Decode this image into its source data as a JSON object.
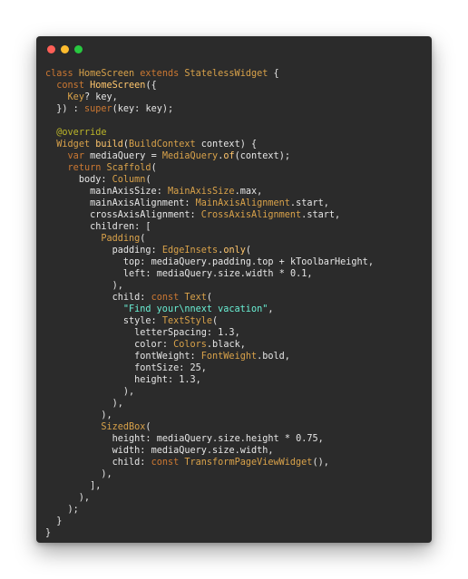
{
  "window": {
    "buttons": [
      {
        "name": "close",
        "color": "#ff5f57"
      },
      {
        "name": "minimize",
        "color": "#febc2e"
      },
      {
        "name": "maximize",
        "color": "#28c840"
      }
    ]
  },
  "code_lines": [
    [
      [
        "kw",
        "class "
      ],
      [
        "type",
        "HomeScreen "
      ],
      [
        "kw",
        "extends "
      ],
      [
        "type",
        "StatelessWidget "
      ],
      [
        "punc",
        "{"
      ]
    ],
    [
      [
        "punc",
        "  "
      ],
      [
        "kw",
        "const "
      ],
      [
        "fn",
        "HomeScreen"
      ],
      [
        "punc",
        "({"
      ]
    ],
    [
      [
        "punc",
        "    "
      ],
      [
        "type",
        "Key"
      ],
      [
        "punc",
        "? "
      ],
      [
        "id",
        "key"
      ],
      [
        "punc",
        ","
      ]
    ],
    [
      [
        "punc",
        "  }) : "
      ],
      [
        "kw",
        "super"
      ],
      [
        "punc",
        "("
      ],
      [
        "id",
        "key"
      ],
      [
        "punc",
        ": "
      ],
      [
        "id",
        "key"
      ],
      [
        "punc",
        ");"
      ]
    ],
    [
      [
        "punc",
        ""
      ]
    ],
    [
      [
        "punc",
        "  "
      ],
      [
        "ann",
        "@override"
      ]
    ],
    [
      [
        "punc",
        "  "
      ],
      [
        "type",
        "Widget "
      ],
      [
        "fn",
        "build"
      ],
      [
        "punc",
        "("
      ],
      [
        "type",
        "BuildContext "
      ],
      [
        "id",
        "context"
      ],
      [
        "punc",
        ") {"
      ]
    ],
    [
      [
        "punc",
        "    "
      ],
      [
        "kw",
        "var "
      ],
      [
        "id",
        "mediaQuery "
      ],
      [
        "punc",
        "= "
      ],
      [
        "type",
        "MediaQuery"
      ],
      [
        "punc",
        "."
      ],
      [
        "fn",
        "of"
      ],
      [
        "punc",
        "("
      ],
      [
        "id",
        "context"
      ],
      [
        "punc",
        ");"
      ]
    ],
    [
      [
        "punc",
        "    "
      ],
      [
        "kw",
        "return "
      ],
      [
        "type",
        "Scaffold"
      ],
      [
        "punc",
        "("
      ]
    ],
    [
      [
        "punc",
        "      "
      ],
      [
        "prop",
        "body"
      ],
      [
        "punc",
        ": "
      ],
      [
        "type",
        "Column"
      ],
      [
        "punc",
        "("
      ]
    ],
    [
      [
        "punc",
        "        "
      ],
      [
        "prop",
        "mainAxisSize"
      ],
      [
        "punc",
        ": "
      ],
      [
        "type",
        "MainAxisSize"
      ],
      [
        "punc",
        "."
      ],
      [
        "prop",
        "max"
      ],
      [
        "punc",
        ","
      ]
    ],
    [
      [
        "punc",
        "        "
      ],
      [
        "prop",
        "mainAxisAlignment"
      ],
      [
        "punc",
        ": "
      ],
      [
        "type",
        "MainAxisAlignment"
      ],
      [
        "punc",
        "."
      ],
      [
        "prop",
        "start"
      ],
      [
        "punc",
        ","
      ]
    ],
    [
      [
        "punc",
        "        "
      ],
      [
        "prop",
        "crossAxisAlignment"
      ],
      [
        "punc",
        ": "
      ],
      [
        "type",
        "CrossAxisAlignment"
      ],
      [
        "punc",
        "."
      ],
      [
        "prop",
        "start"
      ],
      [
        "punc",
        ","
      ]
    ],
    [
      [
        "punc",
        "        "
      ],
      [
        "prop",
        "children"
      ],
      [
        "punc",
        ": ["
      ]
    ],
    [
      [
        "punc",
        "          "
      ],
      [
        "type",
        "Padding"
      ],
      [
        "punc",
        "("
      ]
    ],
    [
      [
        "punc",
        "            "
      ],
      [
        "prop",
        "padding"
      ],
      [
        "punc",
        ": "
      ],
      [
        "type",
        "EdgeInsets"
      ],
      [
        "punc",
        "."
      ],
      [
        "fn",
        "only"
      ],
      [
        "punc",
        "("
      ]
    ],
    [
      [
        "punc",
        "              "
      ],
      [
        "prop",
        "top"
      ],
      [
        "punc",
        ": "
      ],
      [
        "id",
        "mediaQuery"
      ],
      [
        "punc",
        "."
      ],
      [
        "prop",
        "padding"
      ],
      [
        "punc",
        "."
      ],
      [
        "prop",
        "top "
      ],
      [
        "punc",
        "+ "
      ],
      [
        "id",
        "kToolbarHeight"
      ],
      [
        "punc",
        ","
      ]
    ],
    [
      [
        "punc",
        "              "
      ],
      [
        "prop",
        "left"
      ],
      [
        "punc",
        ": "
      ],
      [
        "id",
        "mediaQuery"
      ],
      [
        "punc",
        "."
      ],
      [
        "prop",
        "size"
      ],
      [
        "punc",
        "."
      ],
      [
        "prop",
        "width "
      ],
      [
        "punc",
        "* "
      ],
      [
        "num",
        "0.1"
      ],
      [
        "punc",
        ","
      ]
    ],
    [
      [
        "punc",
        "            ),"
      ]
    ],
    [
      [
        "punc",
        "            "
      ],
      [
        "prop",
        "child"
      ],
      [
        "punc",
        ": "
      ],
      [
        "kw",
        "const "
      ],
      [
        "type",
        "Text"
      ],
      [
        "punc",
        "("
      ]
    ],
    [
      [
        "punc",
        "              "
      ],
      [
        "str",
        "\"Find your\\nnext vacation\""
      ],
      [
        "punc",
        ","
      ]
    ],
    [
      [
        "punc",
        "              "
      ],
      [
        "prop",
        "style"
      ],
      [
        "punc",
        ": "
      ],
      [
        "type",
        "TextStyle"
      ],
      [
        "punc",
        "("
      ]
    ],
    [
      [
        "punc",
        "                "
      ],
      [
        "prop",
        "letterSpacing"
      ],
      [
        "punc",
        ": "
      ],
      [
        "num",
        "1.3"
      ],
      [
        "punc",
        ","
      ]
    ],
    [
      [
        "punc",
        "                "
      ],
      [
        "prop",
        "color"
      ],
      [
        "punc",
        ": "
      ],
      [
        "type",
        "Colors"
      ],
      [
        "punc",
        "."
      ],
      [
        "prop",
        "black"
      ],
      [
        "punc",
        ","
      ]
    ],
    [
      [
        "punc",
        "                "
      ],
      [
        "prop",
        "fontWeight"
      ],
      [
        "punc",
        ": "
      ],
      [
        "type",
        "FontWeight"
      ],
      [
        "punc",
        "."
      ],
      [
        "prop",
        "bold"
      ],
      [
        "punc",
        ","
      ]
    ],
    [
      [
        "punc",
        "                "
      ],
      [
        "prop",
        "fontSize"
      ],
      [
        "punc",
        ": "
      ],
      [
        "num",
        "25"
      ],
      [
        "punc",
        ","
      ]
    ],
    [
      [
        "punc",
        "                "
      ],
      [
        "prop",
        "height"
      ],
      [
        "punc",
        ": "
      ],
      [
        "num",
        "1.3"
      ],
      [
        "punc",
        ","
      ]
    ],
    [
      [
        "punc",
        "              ),"
      ]
    ],
    [
      [
        "punc",
        "            ),"
      ]
    ],
    [
      [
        "punc",
        "          ),"
      ]
    ],
    [
      [
        "punc",
        "          "
      ],
      [
        "type",
        "SizedBox"
      ],
      [
        "punc",
        "("
      ]
    ],
    [
      [
        "punc",
        "            "
      ],
      [
        "prop",
        "height"
      ],
      [
        "punc",
        ": "
      ],
      [
        "id",
        "mediaQuery"
      ],
      [
        "punc",
        "."
      ],
      [
        "prop",
        "size"
      ],
      [
        "punc",
        "."
      ],
      [
        "prop",
        "height "
      ],
      [
        "punc",
        "* "
      ],
      [
        "num",
        "0.75"
      ],
      [
        "punc",
        ","
      ]
    ],
    [
      [
        "punc",
        "            "
      ],
      [
        "prop",
        "width"
      ],
      [
        "punc",
        ": "
      ],
      [
        "id",
        "mediaQuery"
      ],
      [
        "punc",
        "."
      ],
      [
        "prop",
        "size"
      ],
      [
        "punc",
        "."
      ],
      [
        "prop",
        "width"
      ],
      [
        "punc",
        ","
      ]
    ],
    [
      [
        "punc",
        "            "
      ],
      [
        "prop",
        "child"
      ],
      [
        "punc",
        ": "
      ],
      [
        "kw",
        "const "
      ],
      [
        "type",
        "TransformPageViewWidget"
      ],
      [
        "punc",
        "(),"
      ]
    ],
    [
      [
        "punc",
        "          ),"
      ]
    ],
    [
      [
        "punc",
        "        ],"
      ]
    ],
    [
      [
        "punc",
        "      ),"
      ]
    ],
    [
      [
        "punc",
        "    );"
      ]
    ],
    [
      [
        "punc",
        "  }"
      ]
    ],
    [
      [
        "punc",
        "}"
      ]
    ]
  ]
}
